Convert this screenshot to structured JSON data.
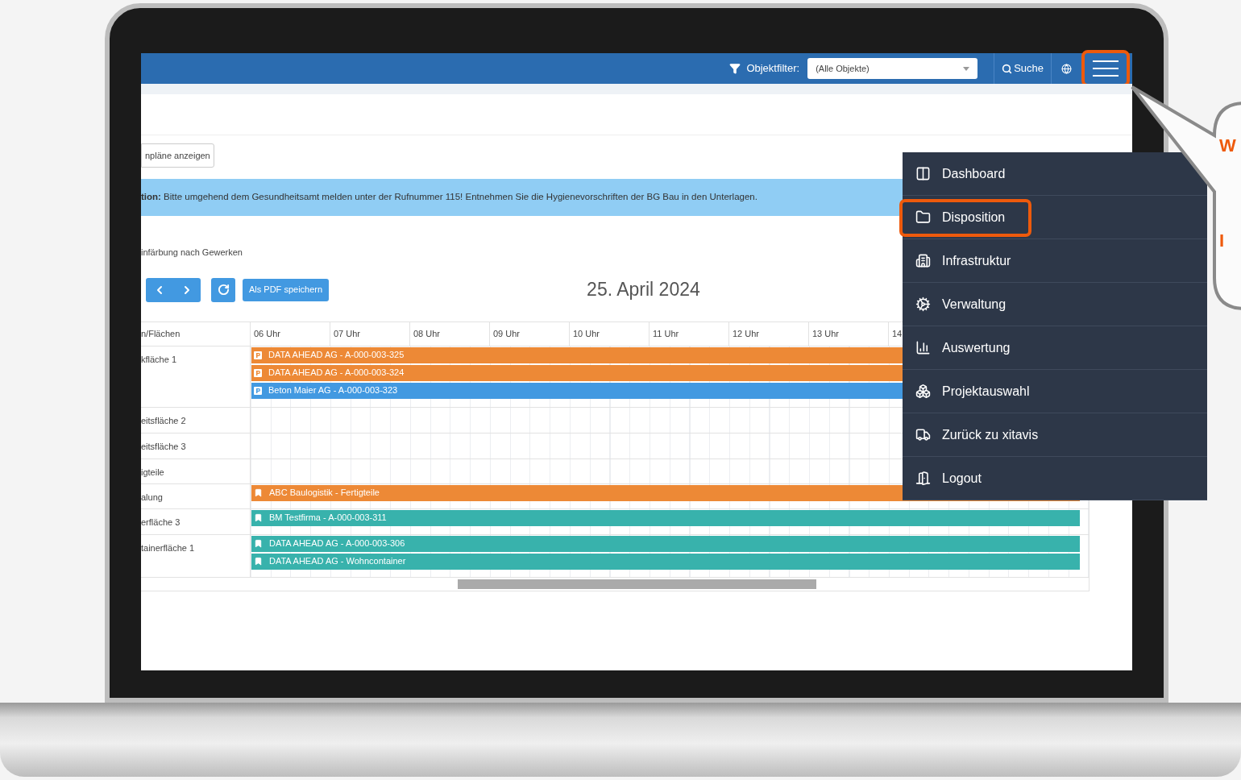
{
  "top_bar": {
    "filter_label": "Objektfilter:",
    "filter_value": "(Alle Objekte)",
    "search_label": "Suche",
    "menu_button": {
      "highlighted": true
    }
  },
  "toggle_button": "npläne anzeigen",
  "alert": "**tion:** Bitte umgehend dem Gesundheitsamt melden unter der Rufnummer 115! Entnehmen Sie die Hygienevorschriften der BG Bau in den Unterlagen.",
  "legend_text": "infärbung nach Gewerken",
  "pdf_button": "Als PDF speichern",
  "date": "25. April 2024",
  "schedule": {
    "column_header": "n/Flächen",
    "hours": [
      "06 Uhr",
      "07 Uhr",
      "08 Uhr",
      "09 Uhr",
      "10 Uhr",
      "11 Uhr",
      "12 Uhr",
      "13 Uhr",
      "14"
    ],
    "rows": [
      {
        "label": "kfläche 1",
        "bars": [
          {
            "kind": "parking",
            "color": "#ed8936",
            "text": "DATA AHEAD AG - A-000-003-325"
          },
          {
            "kind": "parking",
            "color": "#ed8936",
            "text": "DATA AHEAD AG - A-000-003-324"
          },
          {
            "kind": "parking",
            "color": "#4299e1",
            "text": "Beton Maier AG - A-000-003-323"
          }
        ]
      },
      {
        "label": "eitsfläche 2",
        "bars": []
      },
      {
        "label": "eitsfläche 3",
        "bars": []
      },
      {
        "label": "igteile",
        "bars": []
      },
      {
        "label": "alung",
        "bars": [
          {
            "kind": "bookmark",
            "color": "#ed8936",
            "text": "ABC Baulogistik - Fertigteile"
          }
        ]
      },
      {
        "label": "erfläche 3",
        "bars": [
          {
            "kind": "bookmark",
            "color": "#38b2ac",
            "text": "BM Testfirma - A-000-003-311"
          }
        ]
      },
      {
        "label": "tainerfläche 1",
        "bars": [
          {
            "kind": "bookmark",
            "color": "#38b2ac",
            "text": "DATA AHEAD AG - A-000-003-306"
          },
          {
            "kind": "bookmark",
            "color": "#38b2ac",
            "text": "DATA AHEAD AG - Wohncontainer"
          }
        ]
      }
    ]
  },
  "menu": {
    "items": [
      {
        "kind": "dashboard",
        "label": "Dashboard",
        "highlighted": false
      },
      {
        "kind": "folder",
        "label": "Disposition",
        "highlighted": true
      },
      {
        "kind": "building",
        "label": "Infrastruktur",
        "highlighted": false
      },
      {
        "kind": "gears",
        "label": "Verwaltung",
        "highlighted": false
      },
      {
        "kind": "chart",
        "label": "Auswertung",
        "highlighted": false
      },
      {
        "kind": "boxes",
        "label": "Projektauswahl",
        "highlighted": false
      },
      {
        "kind": "truck",
        "label": "Zurück zu xitavis",
        "highlighted": false
      },
      {
        "kind": "door",
        "label": "Logout",
        "highlighted": false
      }
    ]
  },
  "callout": {
    "lines": [
      "W",
      "I"
    ]
  }
}
